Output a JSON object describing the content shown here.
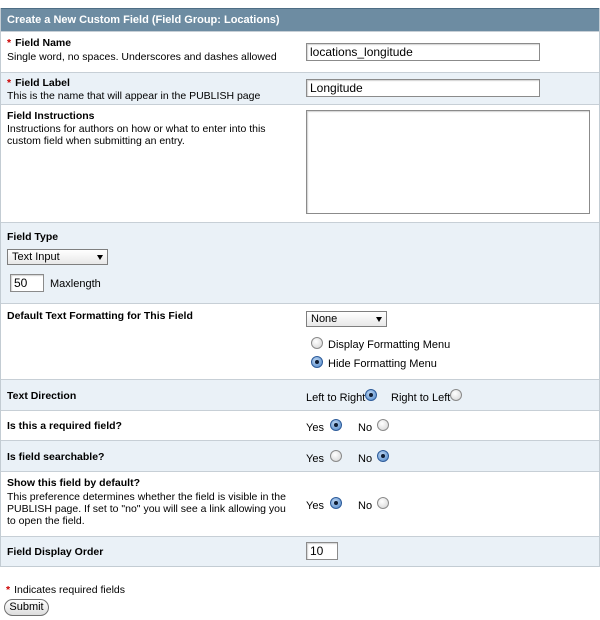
{
  "form": {
    "header": "Create a New Custom Field  (Field Group: Locations)",
    "field_name": {
      "label": "Field Name",
      "desc": "Single word, no spaces. Underscores and dashes allowed",
      "value": "locations_longitude"
    },
    "field_label": {
      "label": "Field Label",
      "desc": "This is the name that will appear in the PUBLISH page",
      "value": "Longitude"
    },
    "instructions": {
      "label": "Field Instructions",
      "desc": "Instructions for authors on how or what to enter into this custom field when submitting an entry.",
      "value": ""
    },
    "field_type": {
      "label": "Field Type",
      "selected": "Text Input",
      "maxlength_value": "50",
      "maxlength_label": "Maxlength"
    },
    "formatting": {
      "label": "Default Text Formatting for This Field",
      "selected": "None",
      "opt_display": "Display Formatting Menu",
      "opt_hide": "Hide Formatting Menu"
    },
    "text_direction": {
      "label": "Text Direction",
      "ltr": "Left to Right",
      "rtl": "Right to Left"
    },
    "required": {
      "label": "Is this a required field?",
      "yes": "Yes",
      "no": "No"
    },
    "searchable": {
      "label": "Is field searchable?",
      "yes": "Yes",
      "no": "No"
    },
    "show_default": {
      "label": "Show this field by default?",
      "desc": "This preference determines whether the field is visible in the PUBLISH page. If set to \"no\" you will see a link allowing you to open the field.",
      "yes": "Yes",
      "no": "No"
    },
    "display_order": {
      "label": "Field Display Order",
      "value": "10"
    },
    "required_note": "Indicates required fields",
    "required_marker": "*",
    "submit_label": "Submit"
  },
  "colors": {
    "header_bg": "#6d8ca2",
    "row_blue": "#eaf1f7",
    "required_marker": "#cc0000",
    "radio_selected": "#4d86c8"
  }
}
